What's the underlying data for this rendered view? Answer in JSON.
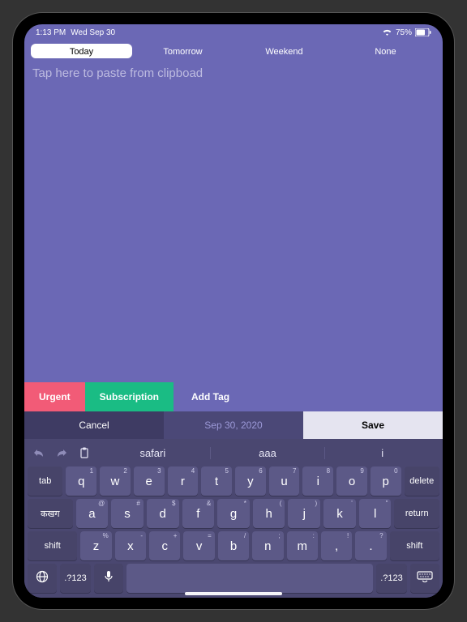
{
  "status": {
    "time": "1:13 PM",
    "date": "Wed Sep 30",
    "battery": "75%"
  },
  "tabs": {
    "items": [
      {
        "label": "Today"
      },
      {
        "label": "Tomorrow"
      },
      {
        "label": "Weekend"
      },
      {
        "label": "None"
      }
    ]
  },
  "textarea": {
    "placeholder": "Tap here to paste from clipboad"
  },
  "tags": {
    "urgent": "Urgent",
    "subscription": "Subscription",
    "add": "Add Tag"
  },
  "actions": {
    "cancel": "Cancel",
    "date": "Sep 30, 2020",
    "save": "Save"
  },
  "keyboard": {
    "suggestions": [
      "safari",
      "aaa",
      "i"
    ],
    "row1_side_left": "tab",
    "row1_side_right": "delete",
    "row1": [
      {
        "k": "q",
        "s": "1"
      },
      {
        "k": "w",
        "s": "2"
      },
      {
        "k": "e",
        "s": "3"
      },
      {
        "k": "r",
        "s": "4"
      },
      {
        "k": "t",
        "s": "5"
      },
      {
        "k": "y",
        "s": "6"
      },
      {
        "k": "u",
        "s": "7"
      },
      {
        "k": "i",
        "s": "8"
      },
      {
        "k": "o",
        "s": "9"
      },
      {
        "k": "p",
        "s": "0"
      }
    ],
    "row2_side_left": "कखग",
    "row2_side_right": "return",
    "row2": [
      {
        "k": "a",
        "s": "@"
      },
      {
        "k": "s",
        "s": "#"
      },
      {
        "k": "d",
        "s": "$"
      },
      {
        "k": "f",
        "s": "&"
      },
      {
        "k": "g",
        "s": "*"
      },
      {
        "k": "h",
        "s": "("
      },
      {
        "k": "j",
        "s": ")"
      },
      {
        "k": "k",
        "s": "'"
      },
      {
        "k": "l",
        "s": "\""
      }
    ],
    "row3_side": "shift",
    "row3": [
      {
        "k": "z",
        "s": "%"
      },
      {
        "k": "x",
        "s": "-"
      },
      {
        "k": "c",
        "s": "+"
      },
      {
        "k": "v",
        "s": "="
      },
      {
        "k": "b",
        "s": "/"
      },
      {
        "k": "n",
        "s": ";"
      },
      {
        "k": "m",
        "s": ":"
      },
      {
        "k": ",",
        "s": "!"
      },
      {
        "k": ".",
        "s": "?"
      }
    ],
    "numkey": ".?123"
  }
}
